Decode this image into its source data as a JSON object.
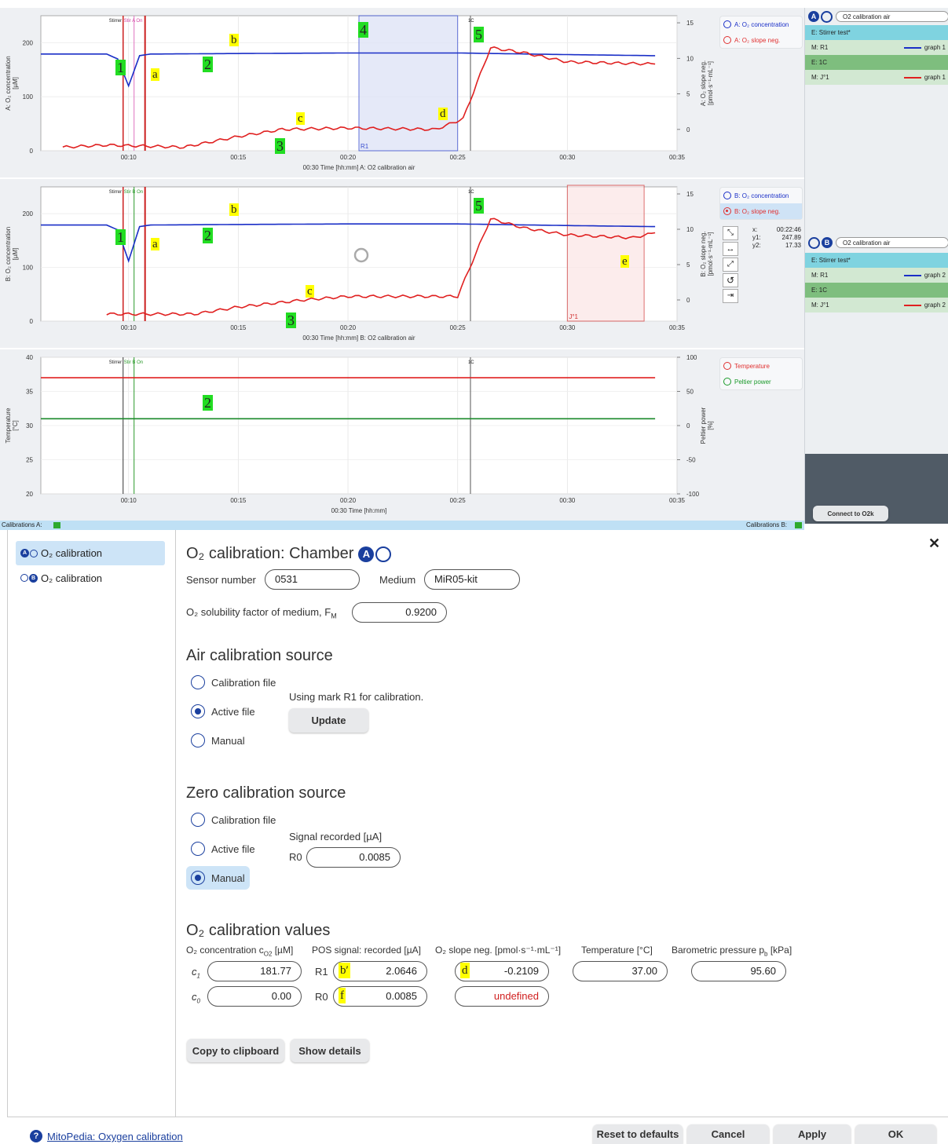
{
  "plots": {
    "panel_a": {
      "left_axis_label": "A: O₂ concentration",
      "left_axis_unit": "[µM]",
      "right_axis_label": "A: O₂ slope neg.",
      "right_axis_unit": "[pmol·s⁻¹·mL⁻¹]",
      "yticks_left": [
        "0",
        "100",
        "200"
      ],
      "yticks_right": [
        "0",
        "5",
        "10",
        "15"
      ],
      "xticks": [
        "00:10",
        "00:15",
        "00:20",
        "00:25",
        "00:30",
        "00:35"
      ],
      "xlabel": "00:30 Time [hh:mm] A: O2 calibration air",
      "event_labels": [
        "Stirrer",
        "Stir A On"
      ],
      "mark_1c": "1C",
      "mark_r1": "R1",
      "legend": [
        "A: O₂ concentration",
        "A: O₂ slope neg."
      ]
    },
    "panel_b": {
      "left_axis_label": "B: O₂ concentration",
      "left_axis_unit": "[µM]",
      "right_axis_label": "B: O₂ slope neg.",
      "right_axis_unit": "[pmol·s⁻¹·mL⁻¹]",
      "yticks_left": [
        "0",
        "100",
        "200"
      ],
      "yticks_right": [
        "0",
        "5",
        "10",
        "15"
      ],
      "xticks": [
        "00:10",
        "00:15",
        "00:20",
        "00:25",
        "00:30",
        "00:35"
      ],
      "xlabel": "00:30 Time [hh:mm] B: O2 calibration air",
      "event_labels": [
        "Stirrer",
        "Stir B On"
      ],
      "mark_1c": "1C",
      "mark_j1": "J°1",
      "legend": [
        "B: O₂ concentration",
        "B: O₂ slope neg."
      ],
      "cursor": {
        "x_label": "x:",
        "x_value": "00:22:46",
        "y1_label": "y1:",
        "y1_value": "247.89",
        "y2_label": "y2:",
        "y2_value": "17.33"
      }
    },
    "panel_c": {
      "left_axis_label": "Temperature",
      "left_axis_unit": "[°C]",
      "right_axis_label": "Peltier power",
      "right_axis_unit": "[%]",
      "yticks_left": [
        "20",
        "25",
        "30",
        "35",
        "40"
      ],
      "yticks_right": [
        "-100",
        "-50",
        "0",
        "50",
        "100"
      ],
      "xticks": [
        "00:10",
        "00:15",
        "00:20",
        "00:25",
        "00:30",
        "00:35"
      ],
      "xlabel": "00:30 Time [hh:mm]",
      "event_labels": [
        "Stirrer",
        "Stir B On"
      ],
      "mark_1c": "1C",
      "legend": [
        "Temperature",
        "Peltier power"
      ]
    },
    "annotations": {
      "one": "1",
      "two": "2",
      "three": "3",
      "four": "4",
      "five": "5",
      "a": "a",
      "b": "b",
      "c": "c",
      "d": "d",
      "e": "e"
    }
  },
  "chart_data": [
    {
      "type": "line",
      "x_unit": "hh:mm",
      "xlim": [
        "00:06",
        "00:35"
      ],
      "series": [
        {
          "name": "A: O₂ concentration",
          "axis": "left",
          "ylim": [
            0,
            250
          ],
          "x": [
            "00:06",
            "00:09",
            "00:09:30",
            "00:10",
            "00:10:30",
            "00:11",
            "00:15",
            "00:20",
            "00:25",
            "00:30",
            "00:34"
          ],
          "y": [
            179,
            179,
            170,
            120,
            176,
            179,
            180,
            181,
            181,
            178,
            176
          ]
        },
        {
          "name": "A: O₂ slope neg.",
          "axis": "right",
          "ylim": [
            -3,
            16
          ],
          "x": [
            "00:07",
            "00:09",
            "00:12:30",
            "00:15",
            "00:17",
            "00:20",
            "00:24",
            "00:25:15",
            "00:26:30",
            "00:28",
            "00:30",
            "00:34"
          ],
          "y": [
            -2.5,
            -2.2,
            -2.5,
            -1.0,
            0.0,
            0.2,
            0.0,
            1.5,
            11.5,
            10.8,
            9.5,
            9.2
          ]
        }
      ]
    },
    {
      "type": "line",
      "x_unit": "hh:mm",
      "xlim": [
        "00:06",
        "00:35"
      ],
      "series": [
        {
          "name": "B: O₂ concentration",
          "axis": "left",
          "ylim": [
            0,
            250
          ],
          "x": [
            "00:06",
            "00:09",
            "00:09:30",
            "00:10",
            "00:10:30",
            "00:11",
            "00:15",
            "00:20",
            "00:25",
            "00:30",
            "00:34"
          ],
          "y": [
            179,
            179,
            170,
            112,
            176,
            179,
            180,
            181,
            181,
            178,
            176
          ]
        },
        {
          "name": "B: O₂ slope neg.",
          "axis": "right",
          "ylim": [
            -3,
            16
          ],
          "x": [
            "00:09",
            "00:13",
            "00:15",
            "00:18",
            "00:20",
            "00:25",
            "00:26:30",
            "00:28",
            "00:30",
            "00:33",
            "00:34"
          ],
          "y": [
            -2.0,
            -2.0,
            -1.0,
            0.0,
            0.5,
            0.5,
            11.5,
            10.2,
            9.2,
            8.8,
            9.5
          ]
        }
      ]
    },
    {
      "type": "line",
      "x_unit": "hh:mm",
      "xlim": [
        "00:06",
        "00:35"
      ],
      "series": [
        {
          "name": "Temperature",
          "axis": "left",
          "ylim": [
            20,
            40
          ],
          "x": [
            "00:06",
            "00:34"
          ],
          "y": [
            37,
            37
          ]
        },
        {
          "name": "Peltier power",
          "axis": "left",
          "ylim": [
            20,
            40
          ],
          "x": [
            "00:06",
            "00:34"
          ],
          "y": [
            31,
            31
          ]
        }
      ]
    }
  ],
  "right_panel": {
    "a_title": "O2 calibration air",
    "b_title": "O2 calibration air",
    "a_items": [
      {
        "label": "E: Stirrer test*",
        "style": "event"
      },
      {
        "label": "M: R1",
        "graph": "graph 1",
        "color": "#1a2fc7"
      },
      {
        "label": "E: 1C",
        "style": "event2"
      },
      {
        "label": "M: J°1",
        "graph": "graph 1",
        "color": "#e02020"
      }
    ],
    "b_items": [
      {
        "label": "E: Stirrer test*",
        "style": "event"
      },
      {
        "label": "M: R1",
        "graph": "graph 2",
        "color": "#1a2fc7"
      },
      {
        "label": "E: 1C",
        "style": "event2"
      },
      {
        "label": "M: J°1",
        "graph": "graph 2",
        "color": "#e02020"
      }
    ],
    "connect_button": "Connect to O2k"
  },
  "calib_bar": {
    "left": "Calibrations A:",
    "right": "Calibrations B:"
  },
  "dialog": {
    "sidebar": [
      {
        "label": "O₂ calibration",
        "chamber": "A"
      },
      {
        "label": "O₂ calibration",
        "chamber": "B"
      }
    ],
    "title": "O₂ calibration: Chamber",
    "title_badge": "A",
    "sensor_label": "Sensor number",
    "sensor_value": "0531",
    "medium_label": "Medium",
    "medium_value": "MiR05-kit",
    "solubility_label": "O₂ solubility factor of medium, F",
    "solubility_sub": "M",
    "solubility_value": "0.9200",
    "air_title": "Air calibration source",
    "air_options": [
      "Calibration file",
      "Active file",
      "Manual"
    ],
    "air_selected": 1,
    "air_note": "Using mark R1 for calibration.",
    "update_button": "Update",
    "zero_title": "Zero calibration source",
    "zero_options": [
      "Calibration file",
      "Active file",
      "Manual"
    ],
    "zero_selected": 2,
    "signal_label": "Signal recorded [µA]",
    "r0_label": "R0",
    "r0_value": "0.0085",
    "values_title": "O₂ calibration values",
    "headers": {
      "conc": "O₂ concentration c",
      "conc_sub": "O2",
      "conc_unit": " [µM]",
      "pos": "POS signal: recorded [µA]",
      "slope": "O₂ slope neg. [pmol·s⁻¹·mL⁻¹]",
      "temp": "Temperature [°C]",
      "baro": "Barometric pressure p",
      "baro_sub": "b",
      "baro_unit": " [kPa]"
    },
    "row1": {
      "c": "c",
      "c_sub": "1",
      "conc": "181.77",
      "r": "R1",
      "tag": "b′",
      "pos": "2.0646",
      "slope_tag": "d",
      "slope": "-0.2109",
      "temp": "37.00",
      "baro": "95.60"
    },
    "row0": {
      "c": "c",
      "c_sub": "0",
      "conc": "0.00",
      "r": "R0",
      "tag": "f",
      "pos": "0.0085",
      "slope": "undefined"
    },
    "copy_button": "Copy to clipboard",
    "details_button": "Show details",
    "mitopedia_link": "MitoPedia: Oxygen calibration",
    "reset_button": "Reset to defaults",
    "cancel_button": "Cancel",
    "apply_button": "Apply",
    "ok_button": "OK",
    "close": "✕"
  }
}
